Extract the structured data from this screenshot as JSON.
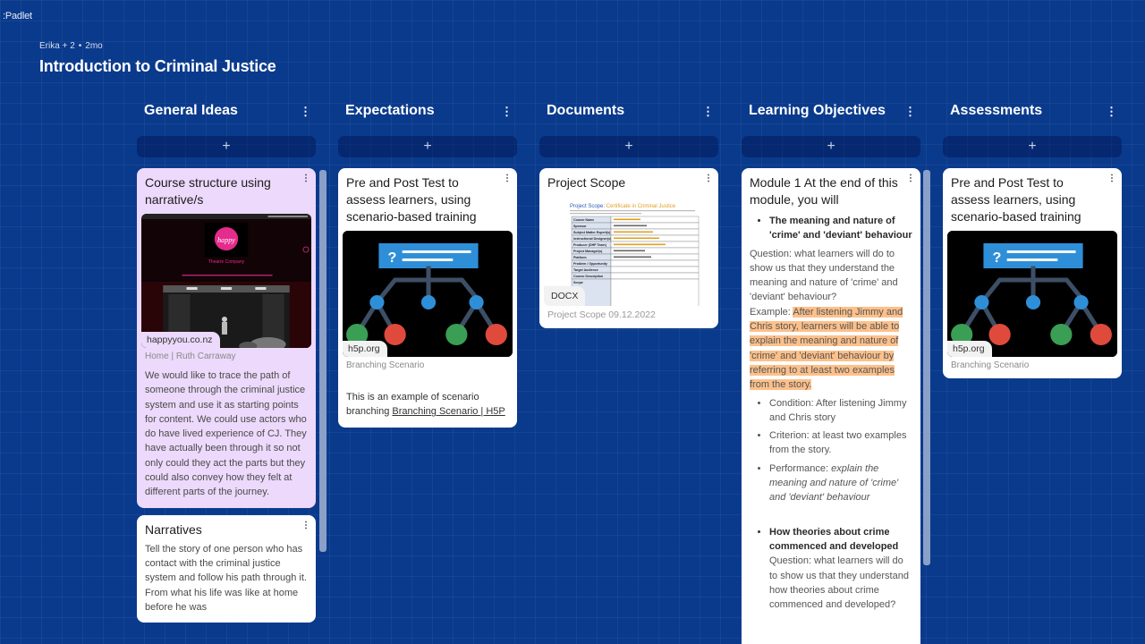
{
  "app": {
    "logo": ":Padlet"
  },
  "header": {
    "author": "Erika",
    "contributors": "+ 2",
    "separator": "•",
    "age": "2mo",
    "title": "Introduction to Criminal Justice"
  },
  "icons": {
    "kebab": "⋮",
    "add": "+"
  },
  "columns": [
    {
      "title": "General Ideas",
      "cards": [
        {
          "title": "Course structure using narrative/s",
          "color": "#ecd9fb",
          "preview": {
            "type": "website",
            "host": "happyyou.co.nz",
            "site_name": "Theatre Company",
            "brand_color": "#e52b8c"
          },
          "caption": "Home | Ruth Carraway",
          "body": "We would like to trace the path of someone through the criminal justice system and use it as starting points for content. We could use actors who do have lived experience of CJ. They have actually been through it so not only could they act the parts but they could also convey how they felt at different parts of the journey."
        },
        {
          "title": "Narratives",
          "color": "#ffffff",
          "body": "Tell the story of one person who has contact with the criminal justice system and follow his path through it. From what his life was like at home before he was"
        }
      ]
    },
    {
      "title": "Expectations",
      "cards": [
        {
          "title": "Pre and Post Test to assess learners, using scenario-based training",
          "preview": {
            "type": "branching-diagram",
            "host": "h5p.org"
          },
          "caption": "Branching Scenario",
          "body_prefix": "This is an example of scenario branching ",
          "link_text": "Branching Scenario | H5P"
        }
      ]
    },
    {
      "title": "Documents",
      "cards": [
        {
          "title": "Project Scope",
          "preview": {
            "type": "document",
            "file_type": "DOCX",
            "doc_heading": "Project Scope: Certificate in Criminal Justice",
            "rows": [
              "Course Name",
              "Sponsor",
              "Subject Matter Expert(s)",
              "Instructional Designer(s)",
              "Producer (DHP Team)",
              "Project Manager(s)",
              "Platform",
              "Problem / Opportunity",
              "Target Audience",
              "Course Description",
              "Scope"
            ]
          },
          "caption": "Project Scope 09.12.2022"
        }
      ]
    },
    {
      "title": "Learning Objectives",
      "cards": [
        {
          "title": "Module 1 At the end of this module, you will",
          "bullet1": "The meaning and nature of 'crime' and 'deviant' behaviour",
          "question1": "Question: what learners will do to show us that they understand the meaning and nature of 'crime' and 'deviant' behaviour?",
          "example_label": "Example: ",
          "example_text": "After listening Jimmy and Chris story, learners will be able to explain the meaning and nature of 'crime' and 'deviant' behaviour by referring to at least two examples from the story.",
          "condition": "Condition: After listening Jimmy and Chris story",
          "criterion": "Criterion: at least two examples from the story.",
          "performance_label": "Performance: ",
          "performance_text": "explain the meaning and nature of 'crime' and 'deviant' behaviour",
          "bullet2": "How theories about crime commenced and developed",
          "question2": "Question: what learners will do to show us that they understand how theories about crime commenced and developed?"
        }
      ]
    },
    {
      "title": "Assessments",
      "cards": [
        {
          "title": "Pre and Post Test to assess learners, using scenario-based training",
          "preview": {
            "type": "branching-diagram",
            "host": "h5p.org"
          },
          "caption": "Branching Scenario"
        }
      ]
    }
  ],
  "colors": {
    "background": "#0a3a8c",
    "highlight": "#fdc08a",
    "diagram_blue": "#2e8fd8",
    "diagram_green": "#3a9e55",
    "diagram_red": "#e04a3c",
    "diagram_line": "#3d4f66"
  }
}
